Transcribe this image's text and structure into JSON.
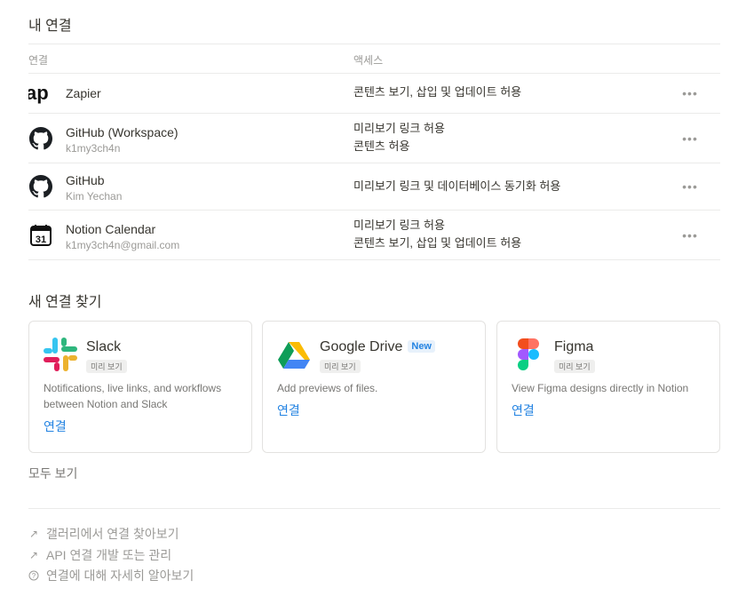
{
  "my_connections": {
    "title": "내 연결",
    "col_connection": "연결",
    "col_access": "액세스",
    "rows": [
      {
        "icon": "zapier-icon",
        "name": "Zapier",
        "sub": "",
        "access": [
          "콘텐츠 보기, 삽입 및 업데이트 허용"
        ]
      },
      {
        "icon": "github-icon",
        "name": "GitHub (Workspace)",
        "sub": "k1my3ch4n",
        "access": [
          "미리보기 링크 허용",
          "콘텐츠 허용"
        ]
      },
      {
        "icon": "github-icon",
        "name": "GitHub",
        "sub": "Kim Yechan",
        "access": [
          "미리보기 링크 및 데이터베이스 동기화 허용"
        ]
      },
      {
        "icon": "calendar-icon",
        "name": "Notion Calendar",
        "sub": "k1my3ch4n@gmail.com",
        "access": [
          "미리보기 링크 허용",
          "콘텐츠 보기, 삽입 및 업데이트 허용"
        ]
      }
    ],
    "more_label": "•••"
  },
  "discover": {
    "title": "새 연결 찾기",
    "cards": [
      {
        "icon": "slack-icon",
        "name": "Slack",
        "badge": "미리 보기",
        "new": "",
        "desc": "Notifications, live links, and workflows between Notion and Slack",
        "connect": "연결"
      },
      {
        "icon": "google-drive-icon",
        "name": "Google Drive",
        "badge": "미리 보기",
        "new": "New",
        "desc": "Add previews of files.",
        "connect": "연결"
      },
      {
        "icon": "figma-icon",
        "name": "Figma",
        "badge": "미리 보기",
        "new": "",
        "desc": "View Figma designs directly in Notion",
        "connect": "연결"
      }
    ],
    "show_all": "모두 보기"
  },
  "links": [
    {
      "icon": "arrow-up-right-icon",
      "label": "갤러리에서 연결 찾아보기"
    },
    {
      "icon": "arrow-up-right-icon",
      "label": "API 연결 개발 또는 관리"
    },
    {
      "icon": "help-circle-icon",
      "label": "연결에 대해 자세히 알아보기"
    }
  ]
}
